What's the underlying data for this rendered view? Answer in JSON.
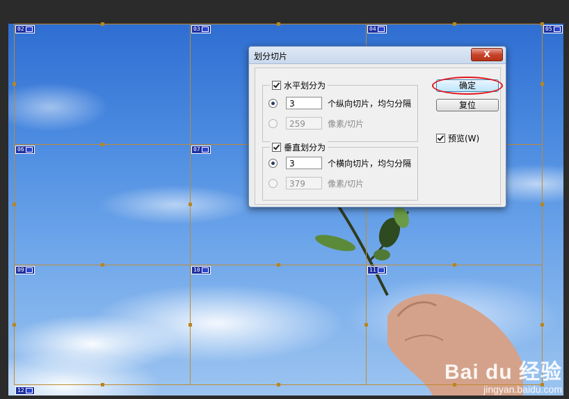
{
  "slices": {
    "tags": [
      "02",
      "03",
      "04",
      "05",
      "06",
      "07",
      "09",
      "10",
      "11",
      "12"
    ]
  },
  "dialog": {
    "title": "划分切片",
    "close_label": "X",
    "horizontal": {
      "label": "水平划分为",
      "count_value": "3",
      "count_label": "个纵向切片，均匀分隔",
      "pixel_value": "259",
      "pixel_label": "像素/切片"
    },
    "vertical": {
      "label": "垂直划分为",
      "count_value": "3",
      "count_label": "个横向切片，均匀分隔",
      "pixel_value": "379",
      "pixel_label": "像素/切片"
    },
    "ok_label": "确定",
    "reset_label": "复位",
    "preview_label": "预览(W)"
  },
  "watermark": {
    "brand": "Bai du 经验",
    "url": "jingyan.baidu.com"
  },
  "colors": {
    "slice_line": "#c08a2e",
    "tag_bg": "#1d2fa0",
    "highlight_ring": "#e0141a"
  }
}
